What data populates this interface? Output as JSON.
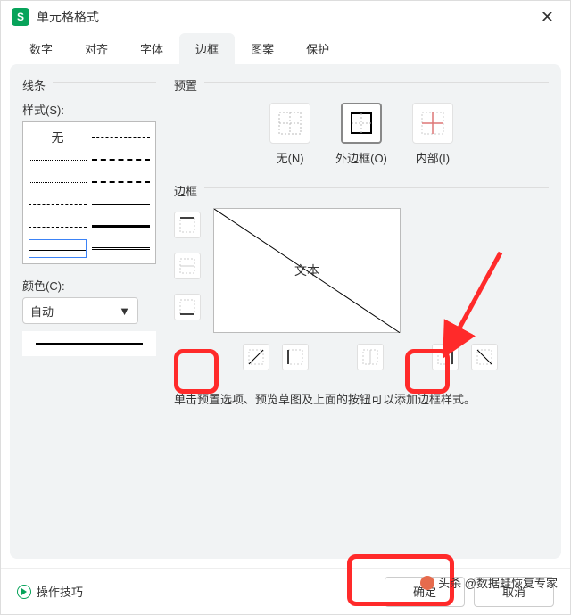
{
  "window": {
    "title": "单元格格式"
  },
  "tabs": [
    "数字",
    "对齐",
    "字体",
    "边框",
    "图案",
    "保护"
  ],
  "active_tab_index": 3,
  "line": {
    "section": "线条",
    "style_label": "样式(S):",
    "none": "无",
    "color_label": "颜色(C):",
    "color_value": "自动"
  },
  "preset": {
    "section": "预置",
    "none": "无(N)",
    "outer": "外边框(O)",
    "inner": "内部(I)"
  },
  "border": {
    "section": "边框",
    "preview_text": "文本"
  },
  "hint": "单击预置选项、预览草图及上面的按钮可以添加边框样式。",
  "footer": {
    "tips": "操作技巧",
    "ok": "确定",
    "cancel": "取消"
  },
  "watermark": "头杀 @数据蛙恢复专家",
  "annotation_color": "#ff2a2a"
}
